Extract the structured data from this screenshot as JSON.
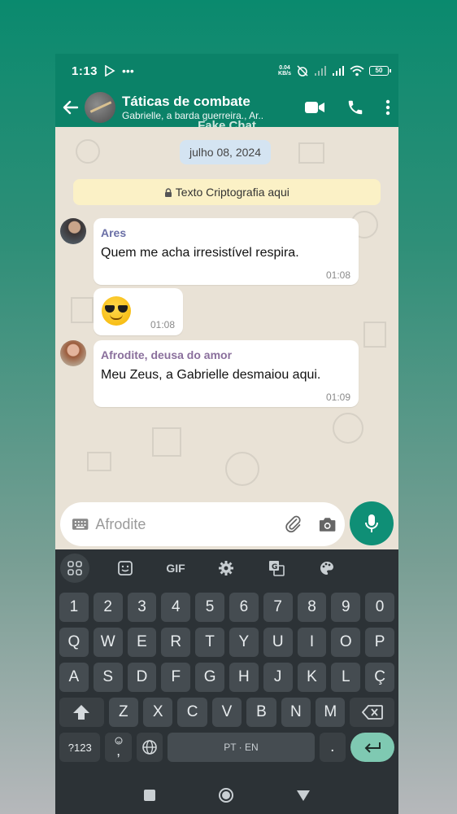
{
  "status_bar": {
    "time": "1:13",
    "net_speed_value": "0.04",
    "net_speed_unit": "KB/s",
    "battery": "50"
  },
  "header": {
    "title": "Táticas de combate",
    "subtitle": "Gabrielle, a barda guerreira., Ar..",
    "watermark": "Fake Chat"
  },
  "chat": {
    "date": "julho 08, 2024",
    "encryption_notice": "Texto Criptografia aqui",
    "messages": [
      {
        "sender": "Ares",
        "sender_color": "#6a6fa6",
        "text": "Quem me acha irresistível respira.",
        "time": "01:08"
      },
      {
        "sender": "",
        "text": "😎",
        "time": "01:08"
      },
      {
        "sender": "Afrodite, deusa do amor",
        "sender_color": "#8a6f9c",
        "text": "Meu Zeus, a Gabrielle desmaiou aqui.",
        "time": "01:09"
      }
    ]
  },
  "composer": {
    "placeholder": "Afrodite"
  },
  "keyboard": {
    "toolbar": [
      "apps-icon",
      "sticker-icon",
      "GIF",
      "settings-icon",
      "translate-icon",
      "palette-icon"
    ],
    "gif_label": "GIF",
    "row_numbers": [
      "1",
      "2",
      "3",
      "4",
      "5",
      "6",
      "7",
      "8",
      "9",
      "0"
    ],
    "row1": [
      "Q",
      "W",
      "E",
      "R",
      "T",
      "Y",
      "U",
      "I",
      "O",
      "P"
    ],
    "row2": [
      "A",
      "S",
      "D",
      "F",
      "G",
      "H",
      "J",
      "K",
      "L",
      "Ç"
    ],
    "row3": [
      "Z",
      "X",
      "C",
      "V",
      "B",
      "N",
      "M"
    ],
    "symbols_key": "?123",
    "emoji_comma": ",",
    "space_label": "PT · EN",
    "period": "."
  },
  "colors": {
    "header": "#0b8268",
    "accent": "#0f8f76",
    "chat_bg": "#e9e2d6",
    "keyboard_bg": "#2c3236"
  }
}
